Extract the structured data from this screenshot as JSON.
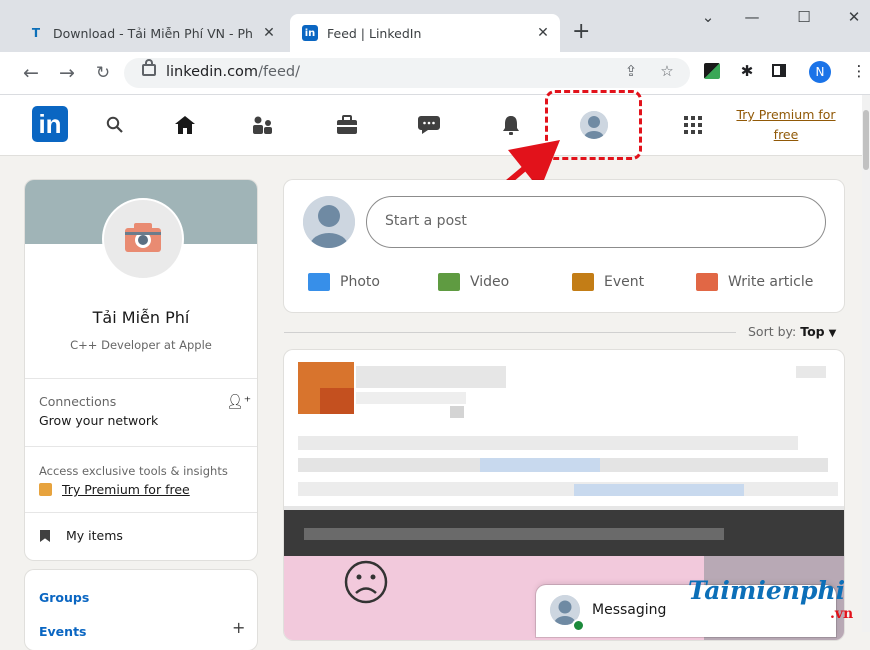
{
  "browser": {
    "tabs": [
      {
        "title": "Download - Tải Miễn Phí VN - Ph",
        "favicon": "T"
      },
      {
        "title": "Feed | LinkedIn",
        "favicon": "in"
      }
    ],
    "new_tab_label": "+",
    "url_host": "linkedin.com",
    "url_path": "/feed/",
    "profile_letter": "N"
  },
  "linkedin": {
    "logo": "in",
    "premium_link": "Try Premium for free",
    "profile": {
      "name": "Tải Miễn Phí",
      "headline": "C++ Developer at Apple",
      "connections_label": "Connections",
      "grow_label": "Grow your network",
      "access_text": "Access exclusive tools & insights",
      "premium_text": "Try Premium for free",
      "my_items": "My items"
    },
    "groups_label": "Groups",
    "events_label": "Events",
    "compose": {
      "placeholder": "Start a post",
      "actions": [
        {
          "label": "Photo",
          "icon": "photo-icon",
          "color": "#378fe9"
        },
        {
          "label": "Video",
          "icon": "video-icon",
          "color": "#5f9b41"
        },
        {
          "label": "Event",
          "icon": "event-icon",
          "color": "#c37d16"
        },
        {
          "label": "Write article",
          "icon": "article-icon",
          "color": "#e16745"
        }
      ]
    },
    "sort": {
      "prefix": "Sort by:",
      "value": "Top"
    },
    "messaging_label": "Messaging"
  },
  "watermark": {
    "main": "Taimienphi",
    "suffix": ".vn"
  },
  "colors": {
    "linkedin_blue": "#0a66c2",
    "highlight": "#e2121b",
    "premium": "#915907"
  }
}
